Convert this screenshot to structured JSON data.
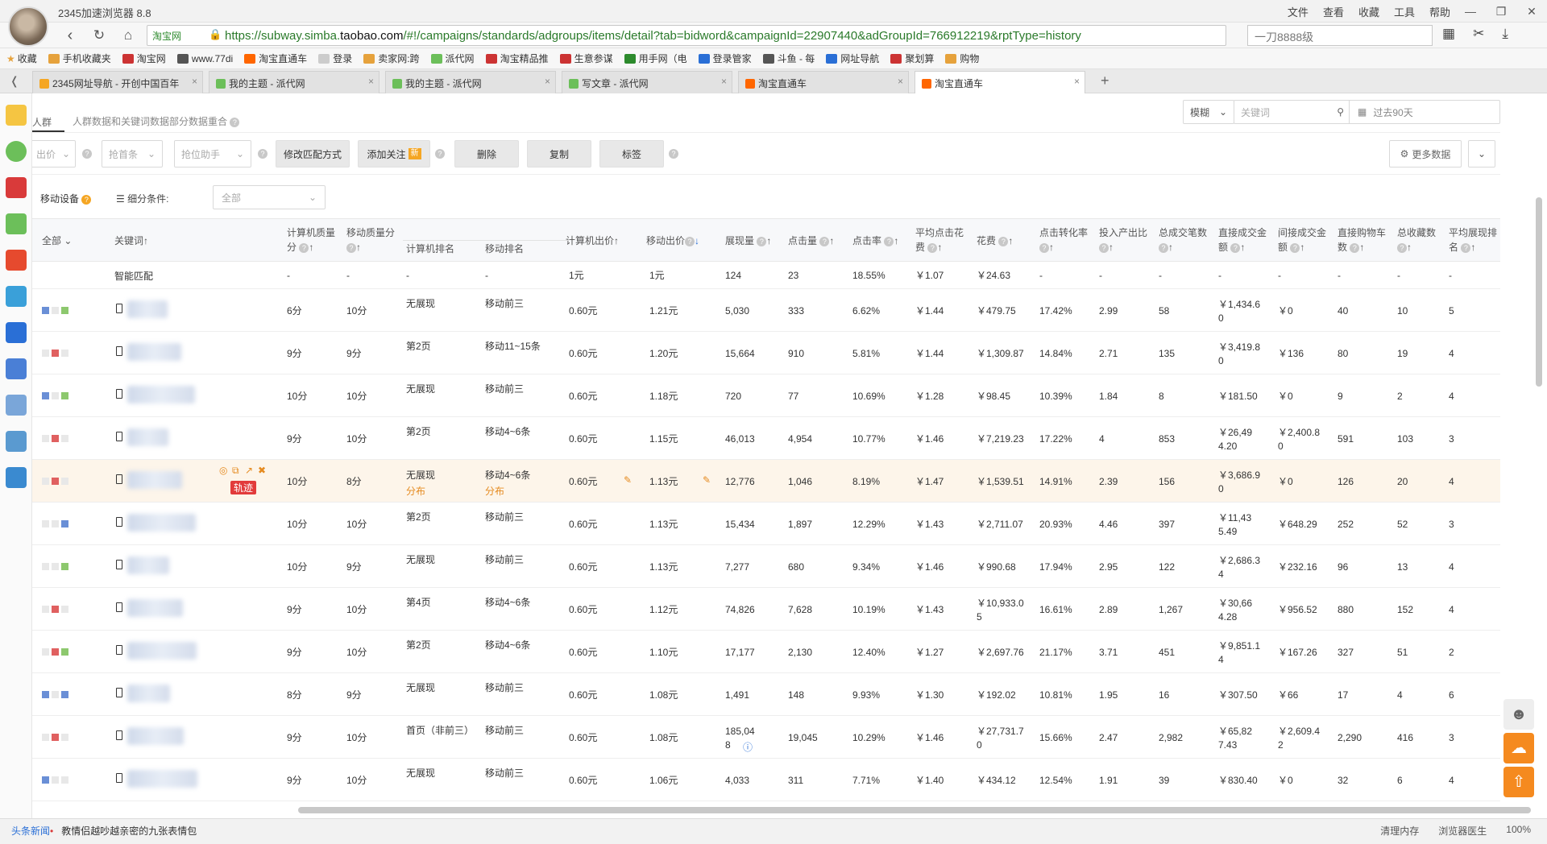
{
  "browser": {
    "title": "2345加速浏览器 8.8",
    "menu": [
      "文件",
      "查看",
      "收藏",
      "工具",
      "帮助"
    ],
    "site_badge": "淘宝网",
    "url_prefix": "https://subway.simba.",
    "url_domain": "taobao.com",
    "url_rest": "/#!/campaigns/standards/adgroups/items/detail?tab=bidword&campaignId=22907440&adGroupId=766912219&rptType=history",
    "search_value": "一刀8888级"
  },
  "bookmarks": [
    "收藏",
    "手机收藏夹",
    "淘宝网",
    "www.77di",
    "淘宝直通车",
    "登录",
    "卖家网:跨",
    "派代网",
    "淘宝精品推",
    "生意参谋",
    "用手网（电",
    "登录管家",
    "斗鱼 - 每",
    "网址导航",
    "聚划算",
    "购物"
  ],
  "tabs": [
    "2345网址导航 - 开创中国百年",
    "我的主题 - 派代网",
    "我的主题 - 派代网",
    "写文章 - 派代网",
    "淘宝直通车",
    "淘宝直通车"
  ],
  "toolbar": {
    "crowd": "人群",
    "hint": "人群数据和关键词数据部分数据重合",
    "match_mode": "模糊",
    "keyword_placeholder": "关键词",
    "date_range": "过去90天",
    "bid_select": "出价",
    "rob_first": "抢首条",
    "rank_helper": "抢位助手",
    "modify_match": "修改匹配方式",
    "add_follow": "添加关注",
    "new_badge": "新",
    "delete": "删除",
    "copy": "复制",
    "tag": "标签",
    "more_data": "更多数据",
    "device": "移动设备",
    "segment_label": "细分条件:",
    "segment_value": "全部"
  },
  "columns": [
    "全部",
    "关键词",
    "计算机质量分",
    "移动质量分",
    "计算机排名",
    "移动排名",
    "计算机出价",
    "移动出价",
    "展现量",
    "点击量",
    "点击率",
    "平均点击花费",
    "花费",
    "点击转化率",
    "投入产出比",
    "总成交笔数",
    "直接成交金额",
    "间接成交金额",
    "直接购物车数",
    "总收藏数",
    "平均展现排名"
  ],
  "smart_row": {
    "name": "智能匹配",
    "pc_q": "-",
    "m_q": "-",
    "pc_rank": "-",
    "m_rank": "-",
    "pc_bid": "1元",
    "m_bid": "1元",
    "imp": "124",
    "clk": "23",
    "ctr": "18.55%",
    "cpc": "￥1.07",
    "cost": "￥24.63",
    "cvr": "-",
    "roi": "-",
    "orders": "-",
    "direct": "-",
    "indirect": "-",
    "cart": "-",
    "fav": "-",
    "avgrank": "-"
  },
  "rows": [
    {
      "pc_q": "6分",
      "m_q": "10分",
      "pc_rank": "无展现",
      "m_rank": "移动前三",
      "pc_bid": "0.60元",
      "m_bid": "1.21元",
      "imp": "5,030",
      "clk": "333",
      "ctr": "6.62%",
      "cpc": "￥1.44",
      "cost": "￥479.75",
      "cvr": "17.42%",
      "roi": "2.99",
      "orders": "58",
      "direct": "￥1,434.6\n0",
      "indirect": "￥0",
      "cart": "40",
      "fav": "10",
      "avgrank": "5"
    },
    {
      "pc_q": "9分",
      "m_q": "9分",
      "pc_rank": "第2页",
      "m_rank": "移动11~15条",
      "pc_bid": "0.60元",
      "m_bid": "1.20元",
      "imp": "15,664",
      "clk": "910",
      "ctr": "5.81%",
      "cpc": "￥1.44",
      "cost": "￥1,309.87",
      "cvr": "14.84%",
      "roi": "2.71",
      "orders": "135",
      "direct": "￥3,419.8\n0",
      "indirect": "￥136",
      "cart": "80",
      "fav": "19",
      "avgrank": "4"
    },
    {
      "pc_q": "10分",
      "m_q": "10分",
      "pc_rank": "无展现",
      "m_rank": "移动前三",
      "pc_bid": "0.60元",
      "m_bid": "1.18元",
      "imp": "720",
      "clk": "77",
      "ctr": "10.69%",
      "cpc": "￥1.28",
      "cost": "￥98.45",
      "cvr": "10.39%",
      "roi": "1.84",
      "orders": "8",
      "direct": "￥181.50",
      "indirect": "￥0",
      "cart": "9",
      "fav": "2",
      "avgrank": "4"
    },
    {
      "pc_q": "9分",
      "m_q": "10分",
      "pc_rank": "第2页",
      "m_rank": "移动4~6条",
      "pc_bid": "0.60元",
      "m_bid": "1.15元",
      "imp": "46,013",
      "clk": "4,954",
      "ctr": "10.77%",
      "cpc": "￥1.46",
      "cost": "￥7,219.23",
      "cvr": "17.22%",
      "roi": "4",
      "orders": "853",
      "direct": "￥26,49\n4.20",
      "indirect": "￥2,400.8\n0",
      "cart": "591",
      "fav": "103",
      "avgrank": "3"
    },
    {
      "pc_q": "10分",
      "m_q": "8分",
      "pc_rank": "无展现",
      "m_rank": "移动4~6条",
      "pc_sub": "分布",
      "m_sub": "分布",
      "pc_bid": "0.60元",
      "m_bid": "1.13元",
      "imp": "12,776",
      "clk": "1,046",
      "ctr": "8.19%",
      "cpc": "￥1.47",
      "cost": "￥1,539.51",
      "cvr": "14.91%",
      "roi": "2.39",
      "orders": "156",
      "direct": "￥3,686.9\n0",
      "indirect": "￥0",
      "cart": "126",
      "fav": "20",
      "avgrank": "4",
      "badge": "轨迹"
    },
    {
      "pc_q": "10分",
      "m_q": "10分",
      "pc_rank": "第2页",
      "m_rank": "移动前三",
      "pc_bid": "0.60元",
      "m_bid": "1.13元",
      "imp": "15,434",
      "clk": "1,897",
      "ctr": "12.29%",
      "cpc": "￥1.43",
      "cost": "￥2,711.07",
      "cvr": "20.93%",
      "roi": "4.46",
      "orders": "397",
      "direct": "￥11,43\n5.49",
      "indirect": "￥648.29",
      "cart": "252",
      "fav": "52",
      "avgrank": "3"
    },
    {
      "pc_q": "10分",
      "m_q": "9分",
      "pc_rank": "无展现",
      "m_rank": "移动前三",
      "pc_bid": "0.60元",
      "m_bid": "1.13元",
      "imp": "7,277",
      "clk": "680",
      "ctr": "9.34%",
      "cpc": "￥1.46",
      "cost": "￥990.68",
      "cvr": "17.94%",
      "roi": "2.95",
      "orders": "122",
      "direct": "￥2,686.3\n4",
      "indirect": "￥232.16",
      "cart": "96",
      "fav": "13",
      "avgrank": "4"
    },
    {
      "pc_q": "9分",
      "m_q": "10分",
      "pc_rank": "第4页",
      "m_rank": "移动4~6条",
      "pc_bid": "0.60元",
      "m_bid": "1.12元",
      "imp": "74,826",
      "clk": "7,628",
      "ctr": "10.19%",
      "cpc": "￥1.43",
      "cost": "￥10,933.0\n5",
      "cvr": "16.61%",
      "roi": "2.89",
      "orders": "1,267",
      "direct": "￥30,66\n4.28",
      "indirect": "￥956.52",
      "cart": "880",
      "fav": "152",
      "avgrank": "4"
    },
    {
      "pc_q": "9分",
      "m_q": "10分",
      "pc_rank": "第2页",
      "m_rank": "移动4~6条",
      "pc_bid": "0.60元",
      "m_bid": "1.10元",
      "imp": "17,177",
      "clk": "2,130",
      "ctr": "12.40%",
      "cpc": "￥1.27",
      "cost": "￥2,697.76",
      "cvr": "21.17%",
      "roi": "3.71",
      "orders": "451",
      "direct": "￥9,851.1\n4",
      "indirect": "￥167.26",
      "cart": "327",
      "fav": "51",
      "avgrank": "2"
    },
    {
      "pc_q": "8分",
      "m_q": "9分",
      "pc_rank": "无展现",
      "m_rank": "移动前三",
      "pc_bid": "0.60元",
      "m_bid": "1.08元",
      "imp": "1,491",
      "clk": "148",
      "ctr": "9.93%",
      "cpc": "￥1.30",
      "cost": "￥192.02",
      "cvr": "10.81%",
      "roi": "1.95",
      "orders": "16",
      "direct": "￥307.50",
      "indirect": "￥66",
      "cart": "17",
      "fav": "4",
      "avgrank": "6"
    },
    {
      "pc_q": "9分",
      "m_q": "10分",
      "pc_rank": "首页（非前三）",
      "m_rank": "移动前三",
      "pc_bid": "0.60元",
      "m_bid": "1.08元",
      "imp": "185,04\n8",
      "clk": "19,045",
      "ctr": "10.29%",
      "cpc": "￥1.46",
      "cost": "￥27,731.7\n0",
      "cvr": "15.66%",
      "roi": "2.47",
      "orders": "2,982",
      "direct": "￥65,82\n7.43",
      "indirect": "￥2,609.4\n2",
      "cart": "2,290",
      "fav": "416",
      "avgrank": "3"
    },
    {
      "pc_q": "9分",
      "m_q": "10分",
      "pc_rank": "无展现",
      "m_rank": "移动前三",
      "pc_bid": "0.60元",
      "m_bid": "1.06元",
      "imp": "4,033",
      "clk": "311",
      "ctr": "7.71%",
      "cpc": "￥1.40",
      "cost": "￥434.12",
      "cvr": "12.54%",
      "roi": "1.91",
      "orders": "39",
      "direct": "￥830.40",
      "indirect": "￥0",
      "cart": "32",
      "fav": "6",
      "avgrank": "4"
    }
  ],
  "status": {
    "news": "头条新闻",
    "ticker": "教情侣越吵越亲密的九张表情包",
    "clear_mem": "清理内存",
    "doctor": "浏览器医生",
    "zoom": "100%"
  },
  "colors": {
    "accent": "#f5a623",
    "link": "#2c8a2c",
    "highlight": "#fdf5ea"
  }
}
